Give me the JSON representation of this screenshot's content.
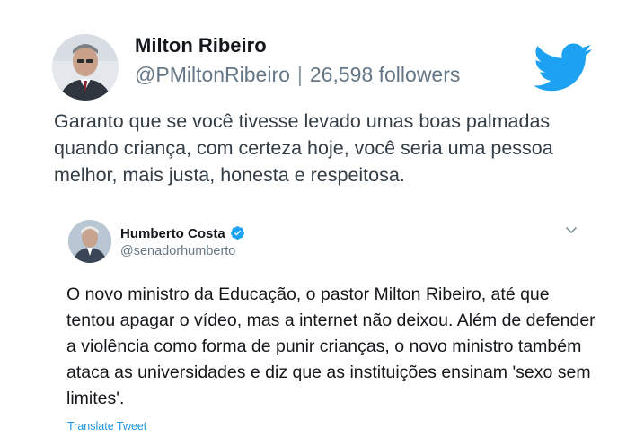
{
  "main_tweet": {
    "name": "Milton Ribeiro",
    "handle": "@PMiltonRibeiro",
    "separator": "|",
    "followers": "26,598 followers",
    "text": "Garanto que se você tivesse levado umas boas palmadas quando criança, com certeza hoje, você seria uma pessoa melhor, mais justa, honesta e respeitosa.",
    "logo": "twitter-bird-icon"
  },
  "quoted_tweet": {
    "name": "Humberto Costa",
    "handle": "@senadorhumberto",
    "verified": true,
    "text": "O novo ministro da Educação, o pastor Milton Ribeiro, até que tentou apagar o vídeo, mas a internet não deixou. Além de defender a violência como forma de punir crianças, o novo ministro também ataca as universidades e diz que as instituições ensinam 'sexo sem limites'.",
    "translate_label": "Translate Tweet",
    "menu_icon": "chevron-down-icon"
  },
  "colors": {
    "twitter_blue": "#1da1f2",
    "link_blue": "#1b95e0",
    "text_dark": "#14171a",
    "text_gray": "#657786"
  }
}
